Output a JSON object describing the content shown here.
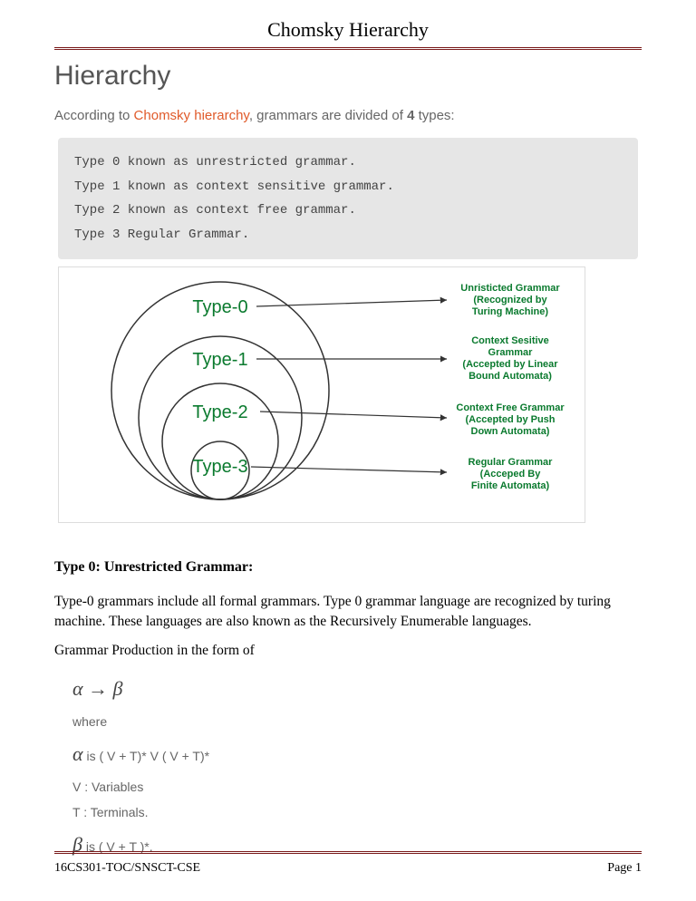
{
  "header": {
    "title": "Chomsky Hierarchy"
  },
  "section": {
    "heading": "Hierarchy"
  },
  "intro": {
    "prefix": "According to ",
    "highlight": "Chomsky hierarchy",
    "mid": ", grammars are divided of ",
    "bold": "4",
    "suffix": " types:"
  },
  "codebox": {
    "line1": "Type 0 known as unrestricted grammar.",
    "line2": "Type 1 known as context sensitive grammar.",
    "line3": "Type 2 known as context free grammar.",
    "line4": "Type 3 Regular Grammar."
  },
  "diagram": {
    "labels": {
      "t0": "Type-0",
      "t1": "Type-1",
      "t2": "Type-2",
      "t3": "Type-3"
    },
    "desc": {
      "t0a": "Unristicted Grammar",
      "t0b": "(Recognized by",
      "t0c": "Turing Machine)",
      "t1a": "Context Sesitive",
      "t1b": "Grammar",
      "t1c": "(Accepted by Linear",
      "t1d": "Bound Automata)",
      "t2a": "Context Free Grammar",
      "t2b": "(Accepted by Push",
      "t2c": "Down Automata)",
      "t3a": "Regular Grammar",
      "t3b": "(Acceped By",
      "t3c": "Finite Automata)"
    }
  },
  "sub": {
    "heading": "Type 0: Unrestricted Grammar:"
  },
  "body": {
    "p1": "Type-0 grammars include all formal grammars. Type 0 grammar language are recognized by turing machine. These languages are also known as the Recursively Enumerable languages.",
    "p2": "Grammar Production in the form of"
  },
  "formula": {
    "rule": "α → β",
    "where": "where",
    "alpha": "α",
    "alpha_def": " is ( V + T)* V ( V + T)*",
    "v": "V : Variables",
    "t": "T : Terminals.",
    "beta": "β",
    "beta_def": " is ( V + T )*."
  },
  "footer": {
    "left": "16CS301-TOC/SNSCT-CSE",
    "right": "Page 1"
  }
}
